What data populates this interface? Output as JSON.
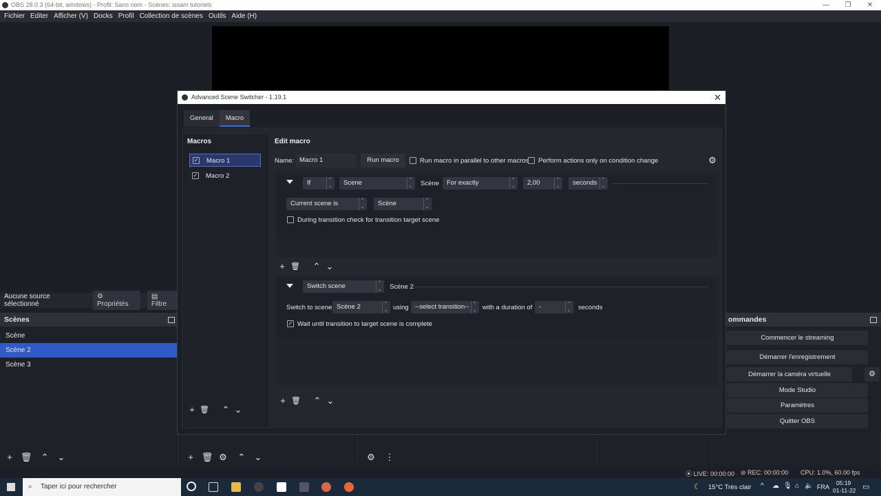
{
  "window": {
    "title": "OBS 28.0.3 (64-bit, windows) - Profil: Sans nom - Scènes: issam tutoriels"
  },
  "menu": [
    "Fichier",
    "Editer",
    "Afficher (V)",
    "Docks",
    "Profil",
    "Collection de scènes",
    "Outils",
    "Aide (H)"
  ],
  "source_bar": {
    "label": "Aucune source sélectionné",
    "properties": "Propriétés",
    "filters": "Filtre"
  },
  "scenes": {
    "title": "Scènes",
    "items": [
      "Scène",
      "Scène 2",
      "Scène 3"
    ],
    "selected_index": 1
  },
  "controls": {
    "title": "ommandes",
    "buttons": [
      "Commencer le streaming",
      "Démarrer l'enregistrement",
      "Démarrer la caméra virtuelle",
      "Mode Studio",
      "Paramètres",
      "Quitter OBS"
    ]
  },
  "status": {
    "live": "LIVE: 00:00:00",
    "rec": "REC: 00:00:00",
    "cpu": "CPU: 1.0%, 60.00 fps"
  },
  "taskbar": {
    "search_placeholder": "Taper ici pour rechercher",
    "weather": "15°C Très clair",
    "lang": "FRA",
    "time": "05:19",
    "date": "01-11-22"
  },
  "dialog": {
    "title": "Advanced Scene Switcher - 1.19.1",
    "tabs": [
      "General",
      "Macro"
    ],
    "active_tab": "Macro",
    "macros_header": "Macros",
    "macros": [
      {
        "name": "Macro 1",
        "checked": true
      },
      {
        "name": "Macro 2",
        "checked": true
      }
    ],
    "edit_header": "Edit macro",
    "name_label": "Name:",
    "name_value": "Macro 1",
    "run_macro": "Run macro",
    "parallel_label": "Run macro in parallel to other macros",
    "parallel_checked": false,
    "on_change_label": "Perform actions only on condition change",
    "on_change_checked": false,
    "condition": {
      "logic": "If",
      "type": "Scene",
      "type_label": "Scène",
      "duration_mode": "For exactly",
      "duration_value": "2,00",
      "duration_unit": "seconds",
      "scene_check": "Current scene is",
      "scene_value": "Scène",
      "transition_check_label": "During transition check for transition target scene",
      "transition_checked": false
    },
    "action": {
      "type": "Switch scene",
      "target_label": "Scène 2",
      "switch_to_label": "Switch to scene",
      "switch_to_value": "Scène 2",
      "using_label": "using",
      "transition_value": "--select transition--",
      "duration_label": "with a duration of",
      "duration_value": "-",
      "seconds_label": "seconds",
      "wait_label": "Wait until transition to target scene is complete",
      "wait_checked": true
    }
  }
}
